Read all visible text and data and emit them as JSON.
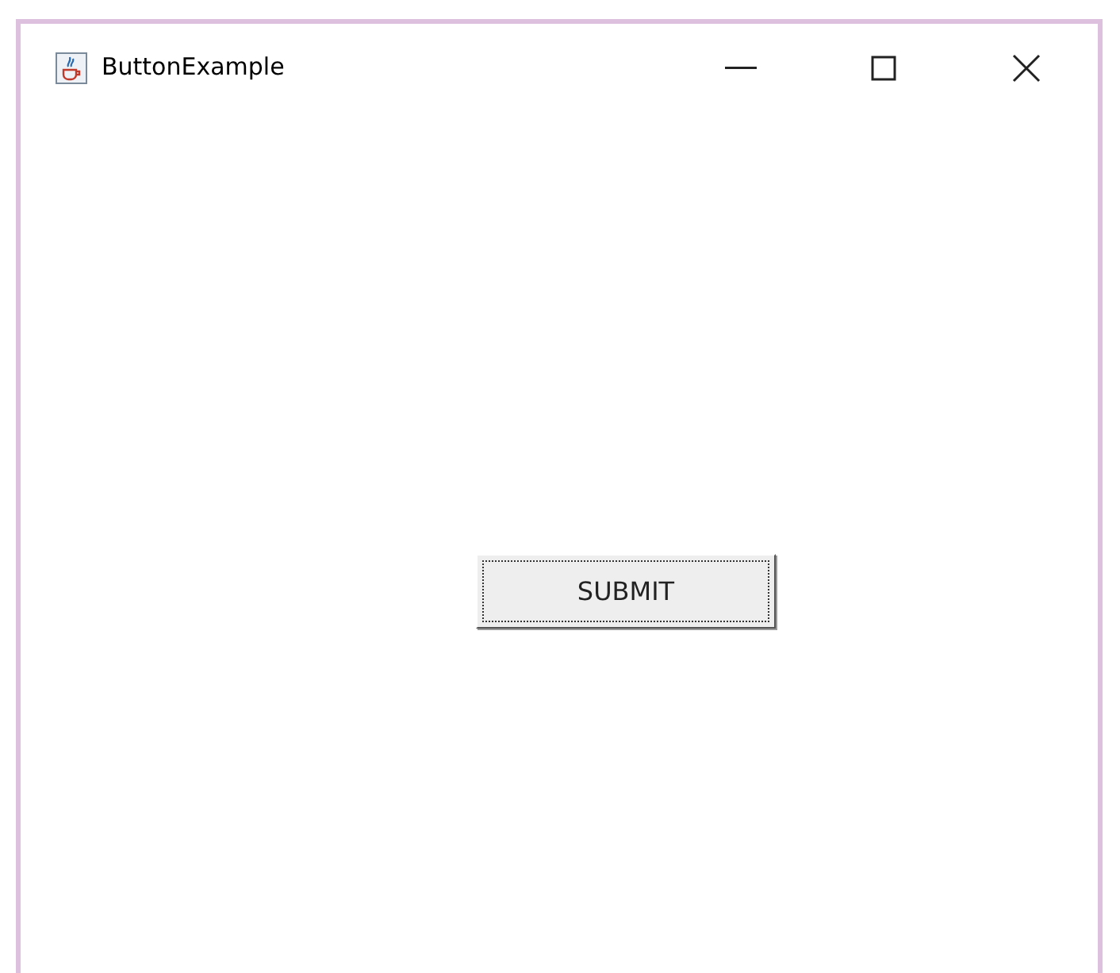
{
  "window": {
    "title": "ButtonExample"
  },
  "button": {
    "label": "SUBMIT",
    "focused": true
  }
}
